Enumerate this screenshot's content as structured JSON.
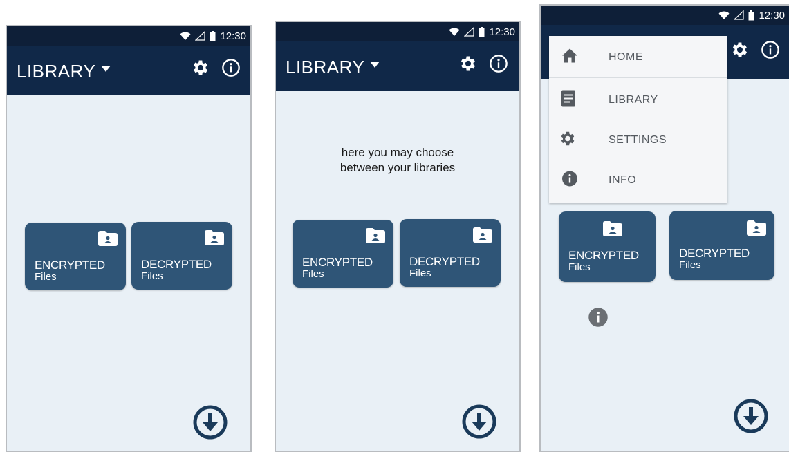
{
  "status": {
    "time": "12:30",
    "wifi_icon": "wifi-icon",
    "signal_icon": "signal-icon",
    "battery_icon": "battery-icon"
  },
  "appbar": {
    "title": "LIBRARY",
    "caret_icon": "caret-down-icon",
    "settings_icon": "gear-icon",
    "info_icon": "info-icon"
  },
  "tiles": {
    "encrypted": {
      "line1": "ENCRYPTED",
      "line2": "Files",
      "icon": "folder-person-icon"
    },
    "decrypted": {
      "line1": "DECRYPTED",
      "line2": "Files",
      "icon": "folder-person-icon"
    }
  },
  "hint": {
    "line1": "here you may choose",
    "line2": "between your libraries"
  },
  "menu": {
    "items": [
      {
        "label": "HOME",
        "icon": "home-icon"
      },
      {
        "label": "LIBRARY",
        "icon": "document-icon"
      },
      {
        "label": "SETTINGS",
        "icon": "gear-icon"
      },
      {
        "label": "INFO",
        "icon": "info-icon"
      }
    ]
  },
  "fab": {
    "icon": "download-circle-icon"
  },
  "colors": {
    "statusbar": "#0e1f38",
    "appbar": "#102848",
    "background": "#e9f0f6",
    "tile": "#2f5577",
    "fab": "#1a3a5a"
  }
}
